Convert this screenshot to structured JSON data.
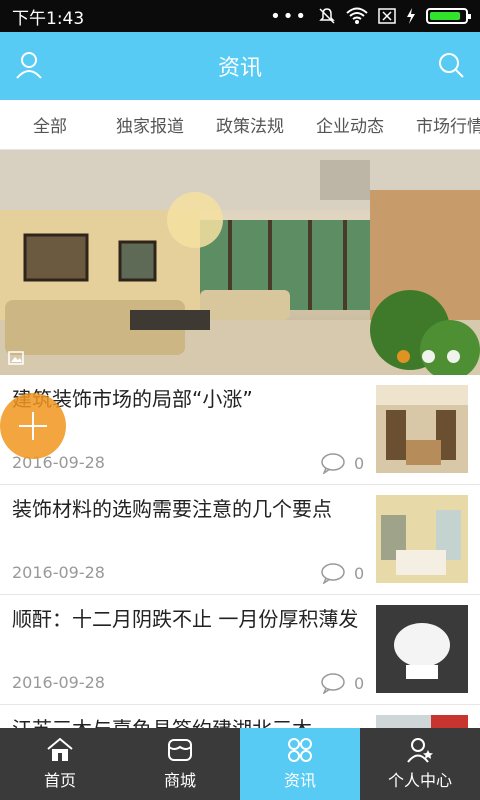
{
  "status_bar": {
    "time": "下午1:43",
    "icons": [
      "more-icon",
      "mute-icon",
      "wifi-icon",
      "sim-icon",
      "charging-icon",
      "battery-icon"
    ]
  },
  "app_bar": {
    "title": "资讯",
    "left_icon": "user-icon",
    "right_icon": "search-icon"
  },
  "tabs": [
    "全部",
    "独家报道",
    "政策法规",
    "企业动态",
    "市场行情"
  ],
  "banner": {
    "dots": 3,
    "active_dot": 0,
    "accent": "#f1961f"
  },
  "news": [
    {
      "title": "建筑装饰市场的局部“小涨”",
      "date": "2016-09-28",
      "comments": "0"
    },
    {
      "title": "装饰材料的选购需要注意的几个要点",
      "date": "2016-09-28",
      "comments": "0"
    },
    {
      "title": "顺酐：十二月阴跌不止 一月份厚积薄发",
      "date": "2016-09-28",
      "comments": "0"
    },
    {
      "title": "江苏三木与嘉鱼县签约建湖北三木",
      "date": "",
      "comments": ""
    }
  ],
  "bottom_nav": [
    {
      "label": "首页",
      "icon": "home-icon"
    },
    {
      "label": "商城",
      "icon": "shop-icon"
    },
    {
      "label": "资讯",
      "icon": "news-icon",
      "active": true
    },
    {
      "label": "个人中心",
      "icon": "profile-icon"
    }
  ],
  "colors": {
    "primary": "#57cbf3",
    "accent": "#f1961f",
    "bottom_bar": "#3a3a3a"
  }
}
